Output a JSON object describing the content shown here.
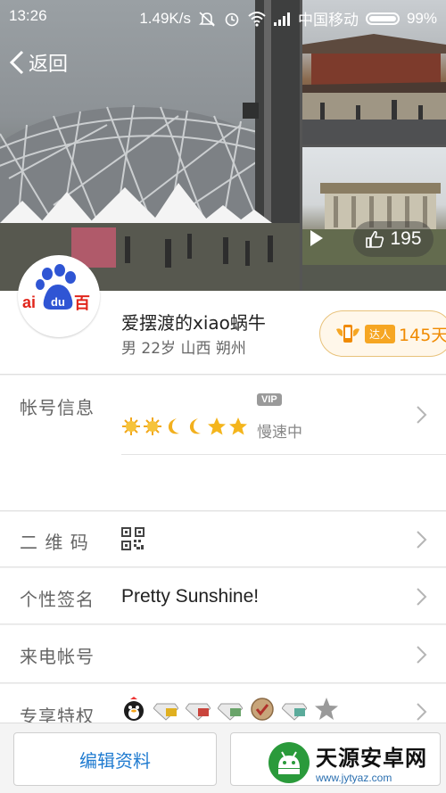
{
  "status_bar": {
    "time": "13:26",
    "network_speed": "1.49K/s",
    "carrier": "中国移动",
    "battery": "99%"
  },
  "nav": {
    "back_label": "返回"
  },
  "header": {
    "like_count": "195"
  },
  "profile": {
    "nickname": "爱摆渡的xiao蜗牛",
    "subinfo": "男 22岁 山西 朔州",
    "expert_tag": "达人",
    "expert_days": "145天",
    "avatar_text_left": "ai",
    "avatar_text_mid": "du",
    "avatar_text_right": "百"
  },
  "account": {
    "label": "帐号信息",
    "vip": "VIP",
    "speed_status": "慢速中",
    "level_icons": [
      "sun-icon",
      "sun-icon",
      "moon-icon",
      "moon-icon",
      "star-icon",
      "star-icon"
    ]
  },
  "rows": {
    "qr_label": "二 维 码",
    "signature_label": "个性签名",
    "signature_value": "Pretty Sunshine!",
    "call_label": "来电帐号",
    "privilege_label": "专享特权"
  },
  "bottom": {
    "edit_label": "编辑资料"
  },
  "watermark": {
    "title": "天源安卓网",
    "url": "www.jytyaz.com"
  },
  "colors": {
    "accent_blue": "#1f7bd0",
    "expert_orange": "#f08a00",
    "watermark_green": "#2a9a3b"
  }
}
